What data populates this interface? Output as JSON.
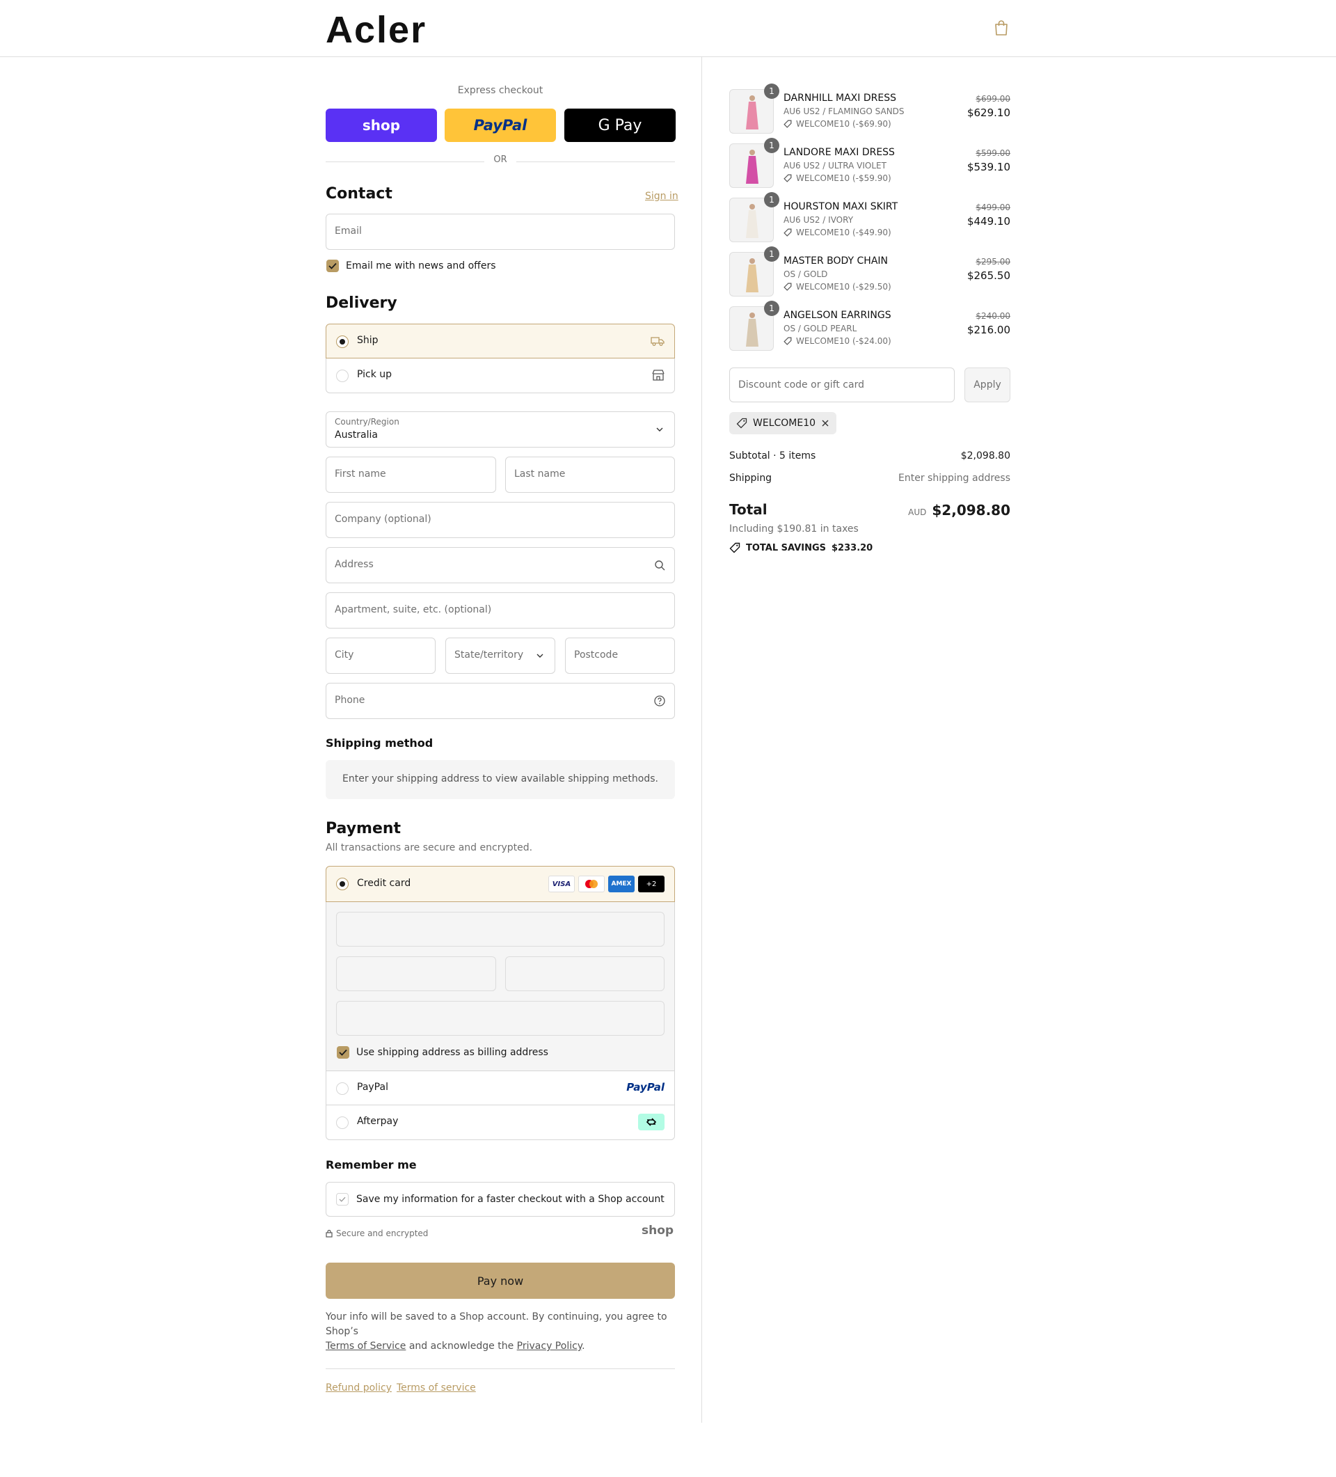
{
  "brand": {
    "logo": "Acler",
    "accent": "#b89b63",
    "pay_button_color": "#c4a878"
  },
  "express": {
    "title": "Express checkout",
    "buttons": [
      {
        "label": "shop",
        "bg": "#5a31f4",
        "color": "#ffffff"
      },
      {
        "label": "PayPal",
        "bg": "#ffc439",
        "color": "#003087"
      },
      {
        "label": "G Pay",
        "bg": "#000000",
        "color": "#ffffff"
      }
    ],
    "or_label": "OR"
  },
  "contact": {
    "heading": "Contact",
    "sign_in": "Sign in",
    "email_placeholder": "Email",
    "newsletter_label": "Email me with news and offers"
  },
  "delivery": {
    "heading": "Delivery",
    "options": [
      {
        "label": "Ship",
        "selected": true,
        "icon": "truck-icon"
      },
      {
        "label": "Pick up",
        "selected": false,
        "icon": "store-icon"
      }
    ],
    "country_label": "Country/Region",
    "country_value": "Australia",
    "placeholders": {
      "first_name": "First name",
      "last_name": "Last name",
      "company": "Company (optional)",
      "address": "Address",
      "apartment": "Apartment, suite, etc. (optional)",
      "city": "City",
      "state": "State/territory",
      "postcode": "Postcode",
      "phone": "Phone"
    }
  },
  "shipping_method": {
    "heading": "Shipping method",
    "notice": "Enter your shipping address to view available shipping methods."
  },
  "payment": {
    "heading": "Payment",
    "subtitle": "All transactions are secure and encrypted.",
    "credit_card_label": "Credit card",
    "card_brands": [
      "VISA",
      "mastercard",
      "AMEX",
      "+2"
    ],
    "billing_checkbox_label": "Use shipping address as billing address",
    "paypal_label": "PayPal",
    "paypal_logo": "PayPal",
    "afterpay_label": "Afterpay"
  },
  "remember": {
    "heading": "Remember me",
    "checkbox_label": "Save my information for a faster checkout with a Shop account",
    "secure_label": "Secure and encrypted",
    "shop_logo": "shop"
  },
  "pay_now": "Pay now",
  "legal": {
    "text_before": "Your info will be saved to a Shop account. By continuing, you agree to Shop’s",
    "terms_link": "Terms of Service",
    "middle": "and acknowledge the",
    "privacy_link": "Privacy Policy",
    "end": "."
  },
  "footer_links": [
    "Refund policy",
    "Terms of service"
  ],
  "cart": {
    "items": [
      {
        "qty": "1",
        "name": "DARNHILL MAXI DRESS",
        "variant": "AU6 US2 / FLAMINGO SANDS",
        "discount": "WELCOME10 (-$69.90)",
        "old_price": "$699.00",
        "price": "$629.10",
        "swatch": "#e88aa8"
      },
      {
        "qty": "1",
        "name": "LANDORE MAXI DRESS",
        "variant": "AU6 US2 / ULTRA VIOLET",
        "discount": "WELCOME10 (-$59.90)",
        "old_price": "$599.00",
        "price": "$539.10",
        "swatch": "#d34fa6"
      },
      {
        "qty": "1",
        "name": "HOURSTON MAXI SKIRT",
        "variant": "AU6 US2 / IVORY",
        "discount": "WELCOME10 (-$49.90)",
        "old_price": "$499.00",
        "price": "$449.10",
        "swatch": "#efeae2"
      },
      {
        "qty": "1",
        "name": "MASTER BODY CHAIN",
        "variant": "OS / GOLD",
        "discount": "WELCOME10 (-$29.50)",
        "old_price": "$295.00",
        "price": "$265.50",
        "swatch": "#e4c79a"
      },
      {
        "qty": "1",
        "name": "ANGELSON EARRINGS",
        "variant": "OS / GOLD PEARL",
        "discount": "WELCOME10 (-$24.00)",
        "old_price": "$240.00",
        "price": "$216.00",
        "swatch": "#d8c9b2"
      }
    ],
    "discount_placeholder": "Discount code or gift card",
    "apply_label": "Apply",
    "applied_code": "WELCOME10",
    "subtotal_label": "Subtotal · 5 items",
    "subtotal_value": "$2,098.80",
    "shipping_label": "Shipping",
    "shipping_value": "Enter shipping address",
    "total_label": "Total",
    "currency": "AUD",
    "total_value": "$2,098.80",
    "taxes_note": "Including $190.81 in taxes",
    "savings_label": "TOTAL SAVINGS",
    "savings_value": "$233.20"
  }
}
